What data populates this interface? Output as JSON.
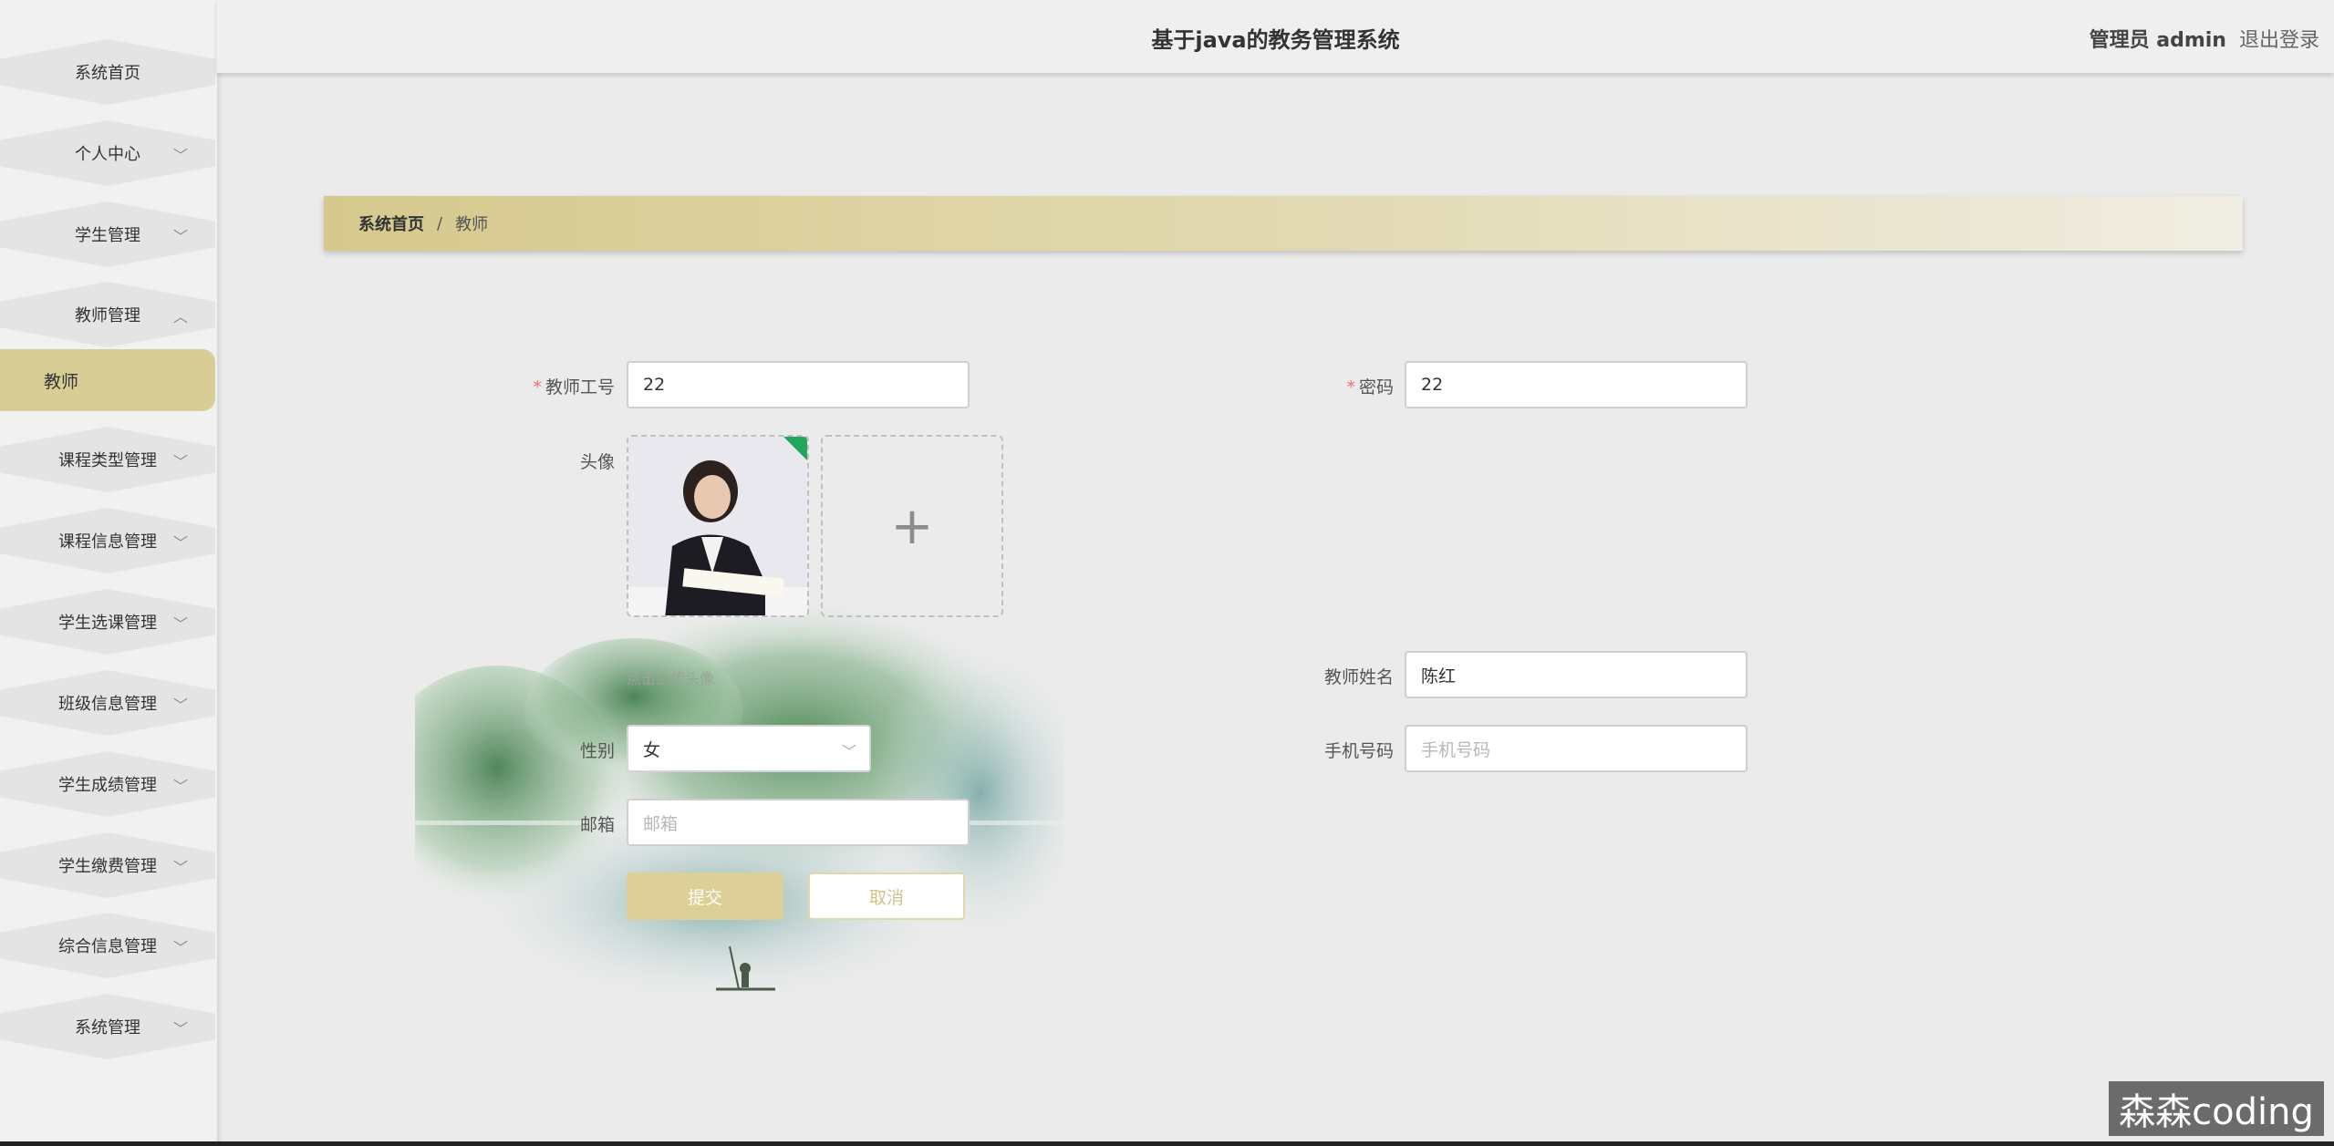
{
  "header": {
    "app_title": "基于java的教务管理系统",
    "user_label": "管理员 admin",
    "logout_label": "退出登录"
  },
  "sidebar": {
    "items": [
      {
        "label": "系统首页",
        "chevron": ""
      },
      {
        "label": "个人中心",
        "chevron": "﹀"
      },
      {
        "label": "学生管理",
        "chevron": "﹀"
      },
      {
        "label": "教师管理",
        "chevron": "︿"
      },
      {
        "label": "课程类型管理",
        "chevron": "﹀"
      },
      {
        "label": "课程信息管理",
        "chevron": "﹀"
      },
      {
        "label": "学生选课管理",
        "chevron": "﹀"
      },
      {
        "label": "班级信息管理",
        "chevron": "﹀"
      },
      {
        "label": "学生成绩管理",
        "chevron": "﹀"
      },
      {
        "label": "学生缴费管理",
        "chevron": "﹀"
      },
      {
        "label": "综合信息管理",
        "chevron": "﹀"
      },
      {
        "label": "系统管理",
        "chevron": "﹀"
      }
    ],
    "active_sub_item": "教师"
  },
  "breadcrumb": {
    "home": "系统首页",
    "separator": "/",
    "current": "教师"
  },
  "form": {
    "teacher_id": {
      "label": "教师工号",
      "value": "22"
    },
    "password": {
      "label": "密码",
      "value": "22"
    },
    "avatar": {
      "label": "头像",
      "upload_tip": "点击上传头像",
      "add_icon": "+"
    },
    "teacher_name": {
      "label": "教师姓名",
      "value": "陈红"
    },
    "phone": {
      "label": "手机号码",
      "placeholder": "手机号码"
    },
    "gender": {
      "label": "性别",
      "value": "女"
    },
    "email": {
      "label": "邮箱",
      "placeholder": "邮箱"
    },
    "submit_label": "提交",
    "cancel_label": "取消"
  },
  "watermark": "森森coding",
  "colors": {
    "accent": "#d8cd95",
    "required_star": "#f56c6c"
  }
}
